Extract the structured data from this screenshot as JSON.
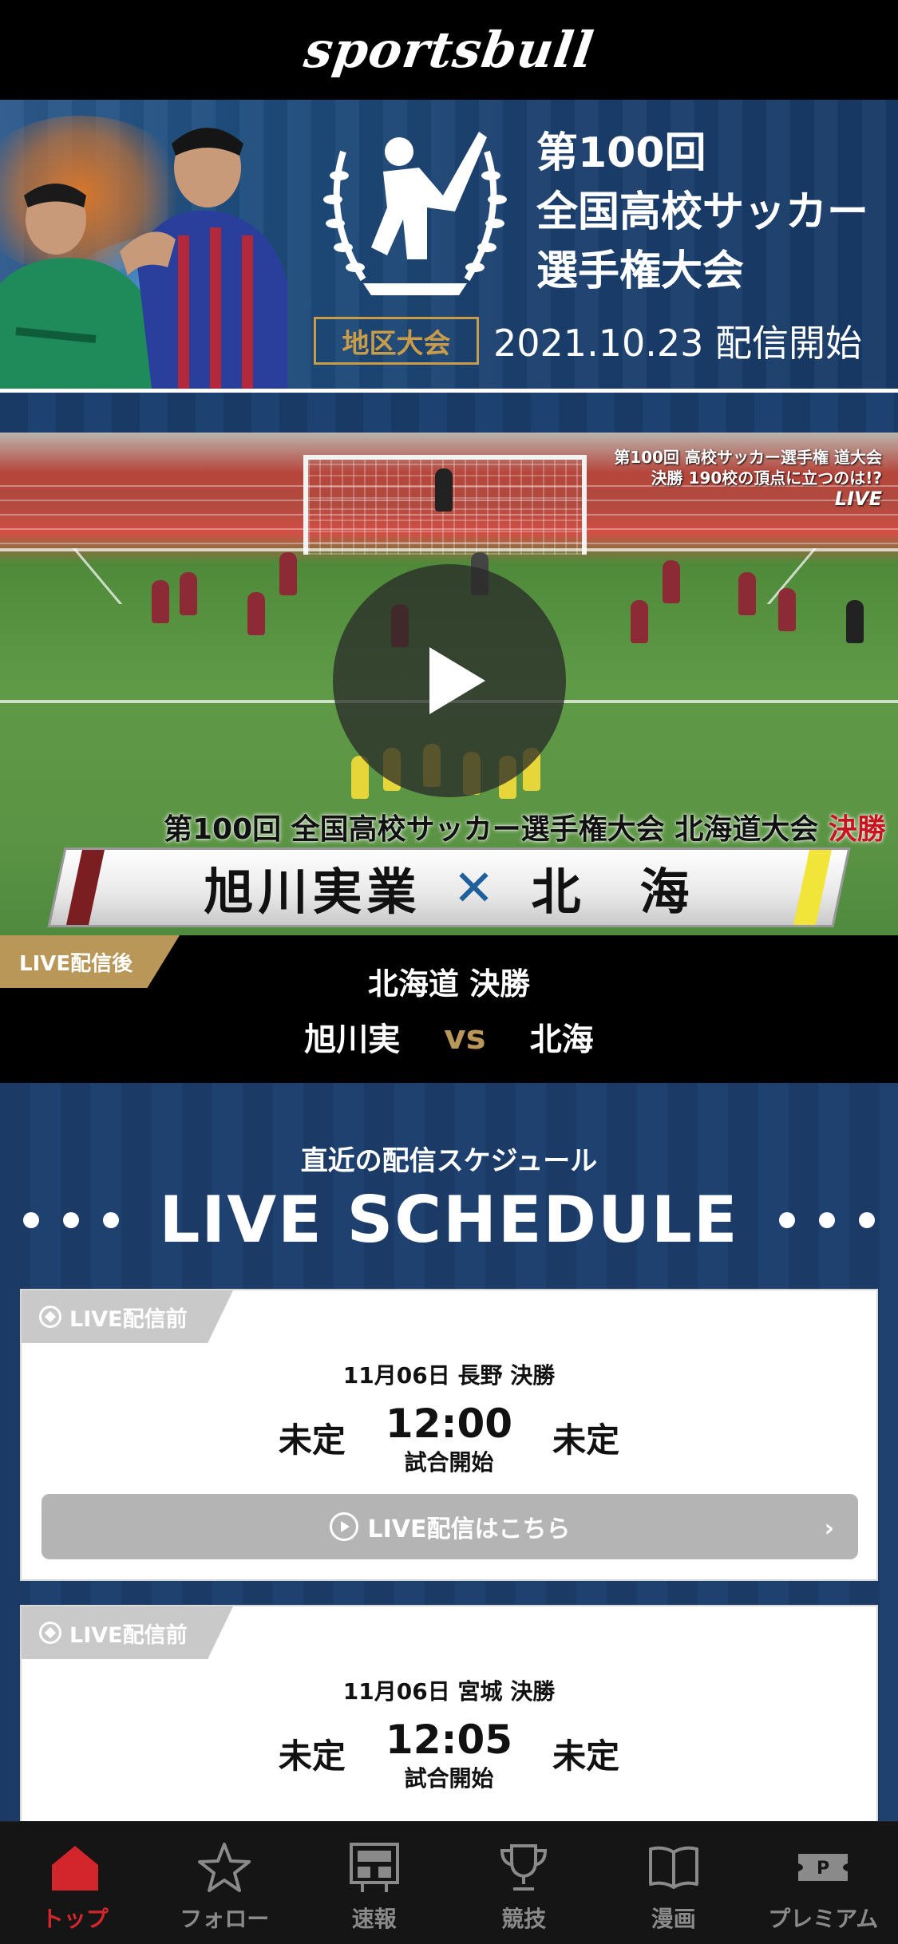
{
  "header": {
    "logo": "sportsbull"
  },
  "banner": {
    "title_line1": "第100回",
    "title_line2": "全国高校サッカー",
    "title_line3": "選手権大会",
    "region_badge": "地区大会",
    "date": "2021.10.23 配信開始"
  },
  "video": {
    "corner_caption_line1": "第100回 高校サッカー選手権 道大会",
    "corner_caption_line2": "決勝 190校の頂点に立つのは!?",
    "corner_live": "LIVE",
    "overlay_title": "第100回 全国高校サッカー選手権大会 北海道大会",
    "overlay_stage": "決勝",
    "overlay_team_home": "旭川実業",
    "overlay_vs": "✕",
    "overlay_team_away": "北　海"
  },
  "match": {
    "status": "LIVE配信後",
    "round": "北海道 決勝",
    "home": "旭川実",
    "vs": "vs",
    "away": "北海"
  },
  "schedule": {
    "subtitle": "直近の配信スケジュール",
    "title": "LIVE SCHEDULE",
    "cards": [
      {
        "status": "LIVE配信前",
        "date": "11月06日 長野 決勝",
        "home": "未定",
        "time": "12:00",
        "kickoff": "試合開始",
        "away": "未定",
        "button": "LIVE配信はこちら"
      },
      {
        "status": "LIVE配信前",
        "date": "11月06日 宮城 決勝",
        "home": "未定",
        "time": "12:05",
        "kickoff": "試合開始",
        "away": "未定"
      }
    ]
  },
  "tabbar": {
    "items": [
      {
        "label": "トップ",
        "icon": "home-icon"
      },
      {
        "label": "フォロー",
        "icon": "star-icon"
      },
      {
        "label": "速報",
        "icon": "scoreboard-icon"
      },
      {
        "label": "競技",
        "icon": "trophy-icon"
      },
      {
        "label": "漫画",
        "icon": "book-icon"
      },
      {
        "label": "プレミアム",
        "icon": "ticket-icon"
      }
    ],
    "active_color": "#d3262c",
    "inactive_color": "#8a8a8a"
  },
  "colors": {
    "gold": "#b89758",
    "navy": "#1b3b66"
  }
}
